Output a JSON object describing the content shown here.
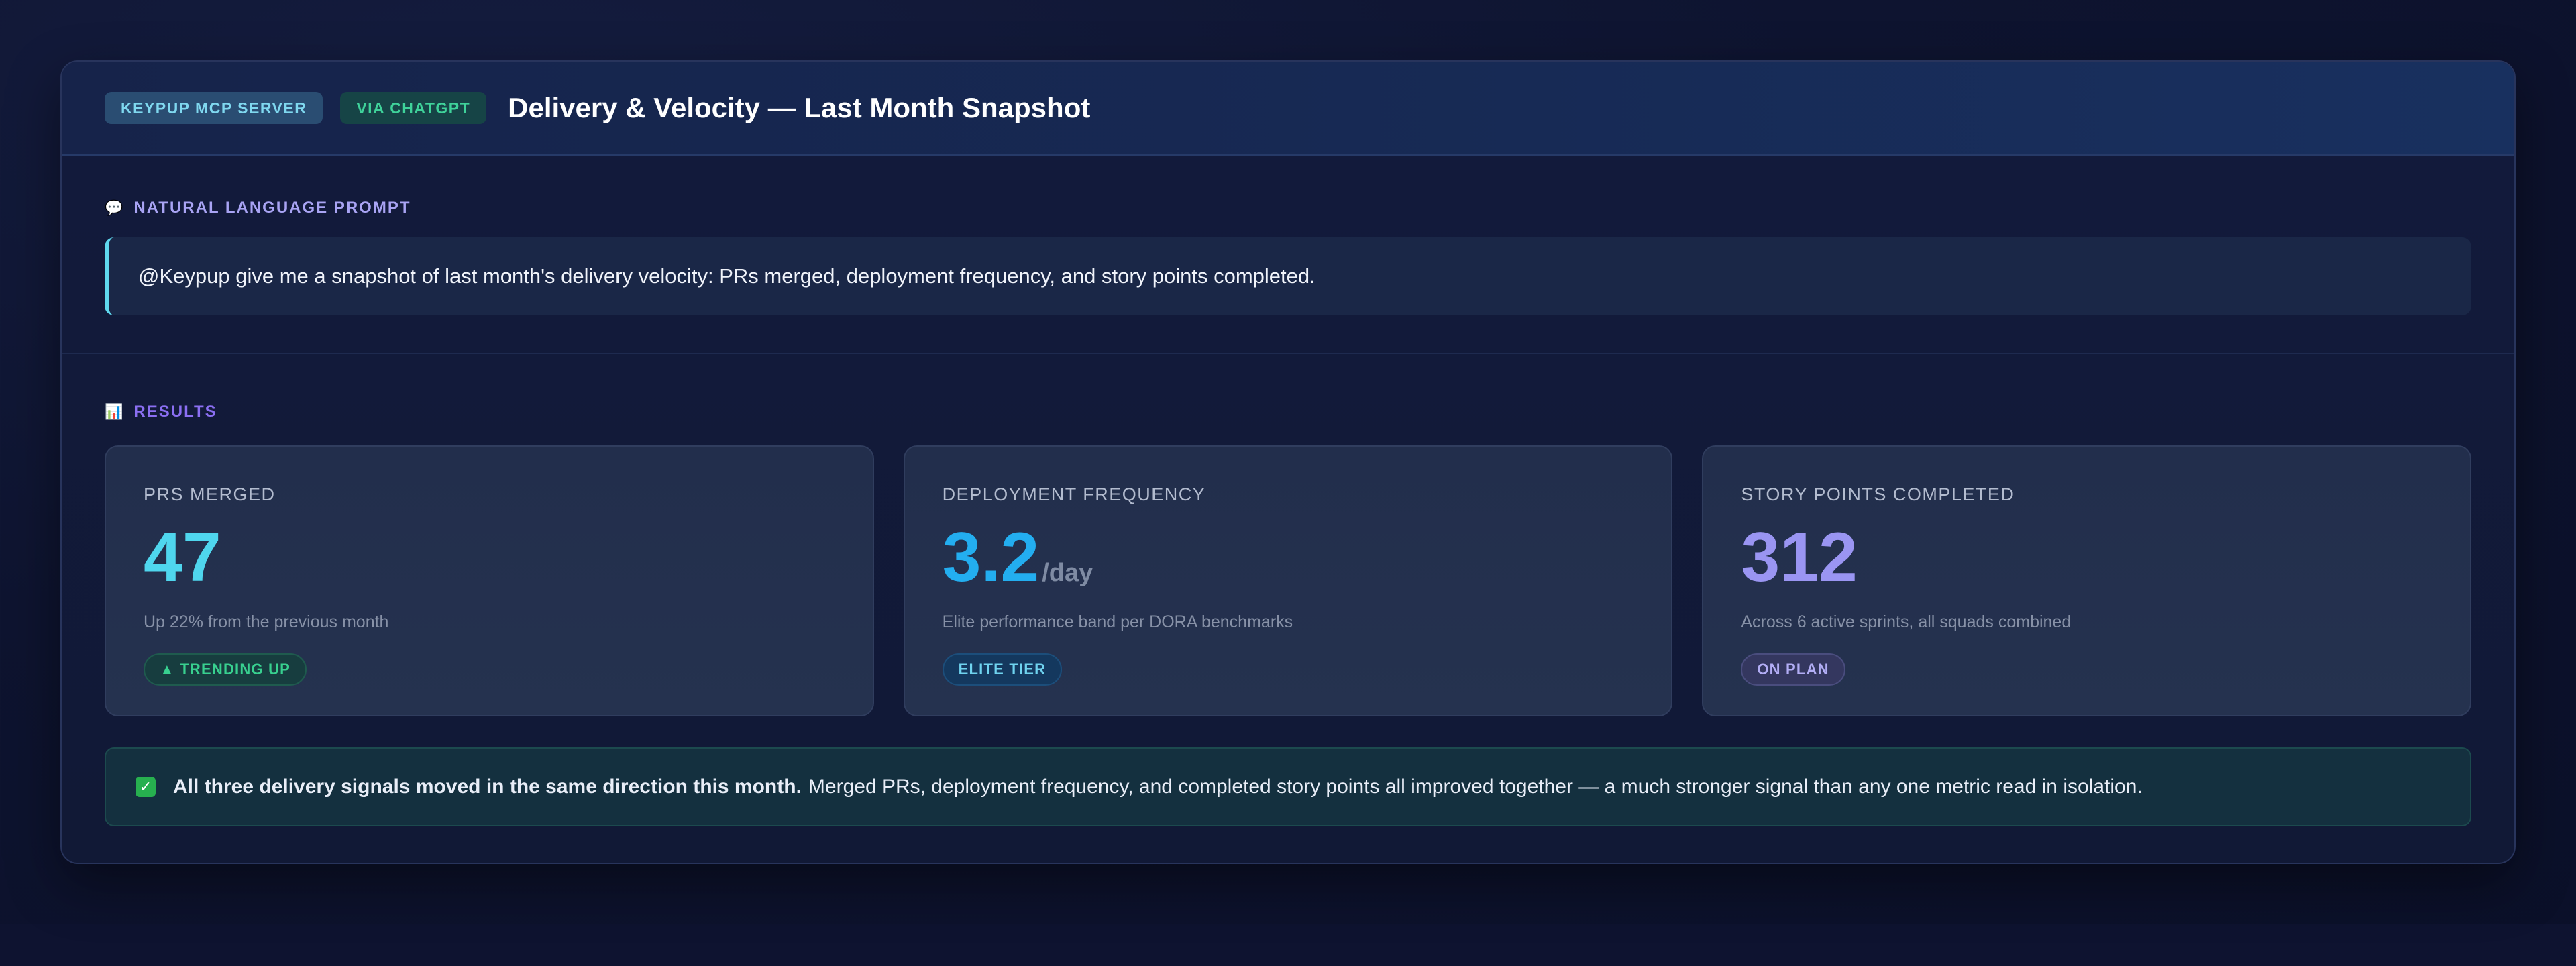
{
  "header": {
    "badge_server": "KEYPUP MCP SERVER",
    "badge_via": "VIA CHATGPT",
    "title": "Delivery & Velocity — Last Month Snapshot"
  },
  "prompt": {
    "icon": "speech-bubble-icon",
    "label": "NATURAL LANGUAGE PROMPT",
    "text": "@Keypup give me a snapshot of last month's delivery velocity: PRs merged, deployment frequency, and story points completed."
  },
  "results": {
    "icon": "bar-chart-icon",
    "label": "RESULTS",
    "cards": [
      {
        "label": "PRS MERGED",
        "value": "47",
        "unit": "",
        "description": "Up 22% from the previous month",
        "badge": "▲ TRENDING UP"
      },
      {
        "label": "DEPLOYMENT FREQUENCY",
        "value": "3.2",
        "unit": "/day",
        "description": "Elite performance band per DORA benchmarks",
        "badge": "ELITE TIER"
      },
      {
        "label": "STORY POINTS COMPLETED",
        "value": "312",
        "unit": "",
        "description": "Across 6 active sprints, all squads combined",
        "badge": "ON PLAN"
      }
    ]
  },
  "summary": {
    "icon": "check-box-icon",
    "bold": "All three delivery signals moved in the same direction this month.",
    "text": "Merged PRs, deployment frequency, and completed story points all improved together — a much stronger signal than any one metric read in isolation."
  },
  "colors": {
    "accent_cyan": "#4fd6ee",
    "accent_blue": "#23aef0",
    "accent_violet": "#9a95f2",
    "success_green": "#38d08f"
  }
}
